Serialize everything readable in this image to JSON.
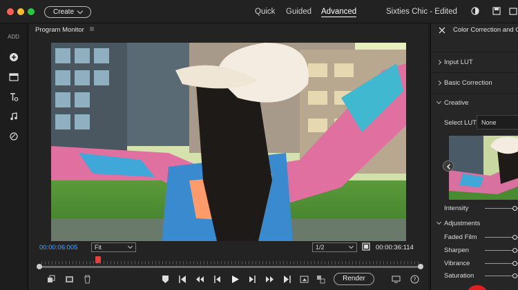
{
  "titlebar": {
    "create_label": "Create",
    "modes": [
      "Quick",
      "Guided",
      "Advanced"
    ],
    "active_mode": "Advanced",
    "doc_title": "Sixties Chic - Edited"
  },
  "leftbar": {
    "add_label": "ADD"
  },
  "program_monitor": {
    "title": "Program Monitor",
    "current_timecode": "00:00:06:005",
    "fit_option": "Fit",
    "zoom_option": "1/2",
    "total_timecode": "00:00:36:114",
    "render_label": "Render",
    "playhead_position": 0.16
  },
  "right_panel": {
    "title": "Color Correction and G",
    "sections": [
      "Input LUT",
      "Basic Correction",
      "Creative"
    ],
    "select_lut_label": "Select LUT",
    "select_lut_value": "None",
    "intensity_label": "Intensity",
    "adjustments_label": "Adjustments",
    "sliders": [
      "Faded Film",
      "Sharpen",
      "Vibrance",
      "Saturation"
    ]
  },
  "colors": {
    "timecode_blue": "#4aa3ff",
    "playhead_red": "#e34040",
    "panel_bg": "#232323"
  }
}
